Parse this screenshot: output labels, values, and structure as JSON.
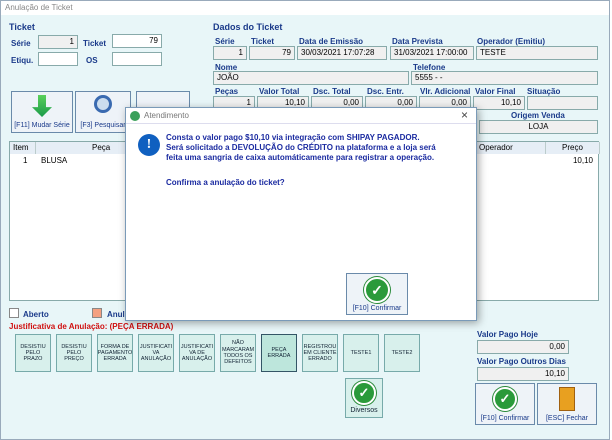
{
  "window": {
    "title": "Anulação de Ticket"
  },
  "ticket_group": {
    "title": "Ticket",
    "serie_label": "Série",
    "serie_value": "1",
    "ticket_label": "Ticket",
    "ticket_value": "79",
    "etiq_label": "Etiqu.",
    "etiq_value": "",
    "os_label": "OS",
    "os_value": ""
  },
  "dados": {
    "title": "Dados do Ticket",
    "serie_label": "Série",
    "serie_value": "1",
    "ticket_label": "Ticket",
    "ticket_value": "79",
    "emissao_label": "Data de Emissão",
    "emissao_value": "30/03/2021 17:07:28",
    "prevista_label": "Data Prevista",
    "prevista_value": "31/03/2021 17:00:00",
    "operador_label": "Operador (Emitiu)",
    "operador_value": "TESTE",
    "nome_label": "Nome",
    "nome_value": "JOÃO",
    "telefone_label": "Telefone",
    "telefone_value": "5555 -  -",
    "pecas_label": "Peças",
    "pecas_value": "1",
    "valor_total_label": "Valor Total",
    "valor_total_value": "10,10",
    "dsc_total_label": "Dsc. Total",
    "dsc_total_value": "0,00",
    "dsc_entr_label": "Dsc. Entr.",
    "dsc_entr_value": "0,00",
    "vlr_adic_label": "Vlr. Adicional",
    "vlr_adic_value": "0,00",
    "valor_final_label": "Valor Final",
    "valor_final_value": "10,10",
    "situacao_label": "Situação",
    "situacao_value": "",
    "origem_label": "Origem Venda",
    "origem_value": "LOJA"
  },
  "toolbar": {
    "mudar_serie": "[F11] Mudar Série",
    "pesquisar": "[F3] Pesquisar"
  },
  "grid": {
    "headers": [
      "Item",
      "Peça",
      "Operador",
      "Preço"
    ],
    "rows": [
      {
        "item": "1",
        "peca": "BLUSA",
        "operador": "",
        "preco": "10,10"
      }
    ]
  },
  "legend": {
    "aberto": "Aberto",
    "anulado": "Anul"
  },
  "justificativa": {
    "title": "Justificativa de Anulação: (PEÇA ERRADA)",
    "buttons": [
      "DESISTIU PELO PRAZO",
      "DESISTIU PELO PREÇO",
      "FORMA DE PAGAMENTO ERRADA",
      "JUSTIFICATI VA ANULAÇÃO",
      "JUSTIFICATI VA DE ANULAÇÃO",
      "NÃO MARCARAM TODOS OS DEFEITOS",
      "PEÇA ERRADA",
      "REGISTROU EM CLIENTE ERRADO",
      "TESTE1",
      "TESTE2"
    ],
    "diversos": "Diversos"
  },
  "pagos": {
    "hoje_label": "Valor Pago Hoje",
    "hoje_value": "0,00",
    "outros_label": "Valor Pago Outros Dias",
    "outros_value": "10,10"
  },
  "footer": {
    "confirmar": "[F10] Confirmar",
    "fechar": "[ESC] Fechar"
  },
  "dialog": {
    "title": "Atendimento",
    "line1": "Consta o valor pago $10,10 via integração com SHIPAY PAGADOR.",
    "line2": "Será solicitado a DEVOLUÇÃO do CRÉDITO na plataforma e a loja será",
    "line3": "feita uma sangria de caixa automáticamente para registrar a operação.",
    "question": "Confirma a anulação do ticket?",
    "confirm": "[F10] Confirmar",
    "close": "×"
  },
  "colors": {
    "accent": "#1a3a8a",
    "red": "#d01010",
    "bg": "#e8f6f8"
  },
  "icons": [
    "arrows-down-icon",
    "magnifier-icon",
    "info-icon",
    "check-icon",
    "exit-door-icon"
  ]
}
